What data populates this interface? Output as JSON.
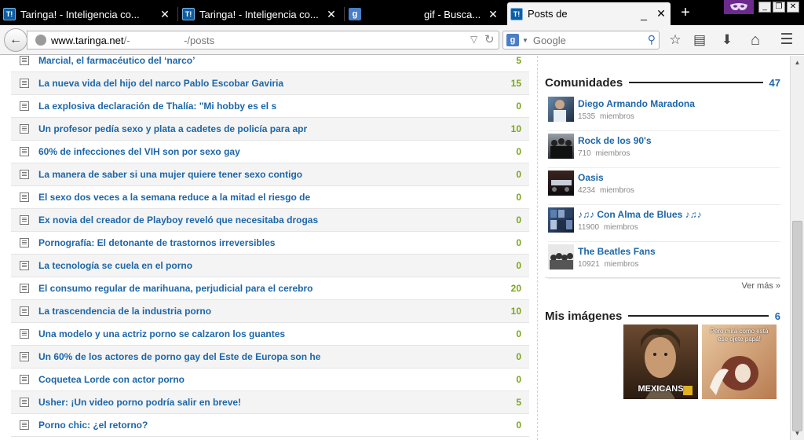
{
  "browser": {
    "tabs": [
      {
        "title": "Taringa! - Inteligencia co...",
        "favicon": "T!",
        "active": false
      },
      {
        "title": "Taringa! - Inteligencia co...",
        "favicon": "T!",
        "active": false
      },
      {
        "title": "",
        "favicon": "g",
        "active": false
      },
      {
        "title": "gif - Busca...",
        "favicon": "",
        "active": false
      },
      {
        "title": "Posts de",
        "favicon": "T!",
        "active": true
      }
    ],
    "close_glyph": "✕",
    "new_tab_glyph": "+",
    "minimize_glyph": "_",
    "maximize_glyph": "❐",
    "window_close_glyph": "✕"
  },
  "navbar": {
    "back_glyph": "←",
    "url_host": "www.taringa.net",
    "url_rest": "/-                   -/posts",
    "dropdown_glyph": "▽",
    "reload_glyph": "↻",
    "search_engine_glyph": "g",
    "search_placeholder": "Google",
    "search_glyph": "⚲",
    "bookmark_glyph": "☆",
    "reader_glyph": "▤",
    "download_glyph": "⬇",
    "home_glyph": "⌂",
    "menu_glyph": "☰"
  },
  "posts": [
    {
      "title": "Marcial, el farmacéutico del ‘narco’",
      "count": "5"
    },
    {
      "title": "La nueva vida del hijo del narco Pablo Escobar Gaviria",
      "count": "15"
    },
    {
      "title": "La explosiva declaración de Thalía: \"Mi hobby es el s",
      "count": "0"
    },
    {
      "title": "Un profesor pedía sexo y plata a cadetes de policía para apr",
      "count": "10"
    },
    {
      "title": "60% de infecciones del VIH son por sexo gay",
      "count": "0"
    },
    {
      "title": "La manera de saber si una mujer quiere tener sexo contigo",
      "count": "0"
    },
    {
      "title": "El sexo dos veces a la semana reduce a la mitad el riesgo de",
      "count": "0"
    },
    {
      "title": "Ex novia del creador de Playboy reveló que necesitaba drogas",
      "count": "0"
    },
    {
      "title": "Pornografía: El detonante de trastornos irreversibles",
      "count": "0"
    },
    {
      "title": "La tecnología se cuela en el porno",
      "count": "0"
    },
    {
      "title": "El consumo regular de marihuana, perjudicial para el cerebro",
      "count": "20"
    },
    {
      "title": "La trascendencia de la industria porno",
      "count": "10"
    },
    {
      "title": "Una modelo y una actriz porno se calzaron los guantes",
      "count": "0"
    },
    {
      "title": "Un 60% de los actores de porno gay del Este de Europa son he",
      "count": "0"
    },
    {
      "title": "Coquetea Lorde con actor porno",
      "count": "0"
    },
    {
      "title": "Usher: ¡Un video porno podría salir en breve!",
      "count": "5"
    },
    {
      "title": "Porno chic: ¿el retorno?",
      "count": "0"
    }
  ],
  "communities": {
    "title": "Comunidades",
    "count": "47",
    "members_label": "miembros",
    "items": [
      {
        "name": "Diego Armando Maradona",
        "members": "1535"
      },
      {
        "name": "Rock de los 90's",
        "members": "710"
      },
      {
        "name": "Oasis",
        "members": "4234"
      },
      {
        "name": "♪♫♪ Con Alma de Blues ♪♫♪",
        "members": "11900"
      },
      {
        "name": "The Beatles Fans",
        "members": "10921"
      }
    ],
    "more_label": "Ver más »"
  },
  "images": {
    "title": "Mis imágenes",
    "count": "6",
    "items": [
      {
        "caption": "MEXICANS"
      },
      {
        "caption": "Pero mirá como está ese ojete papá!"
      }
    ]
  },
  "colors": {
    "link": "#1d66a8",
    "count": "#7ca41b",
    "tab_bg": "#000000"
  }
}
